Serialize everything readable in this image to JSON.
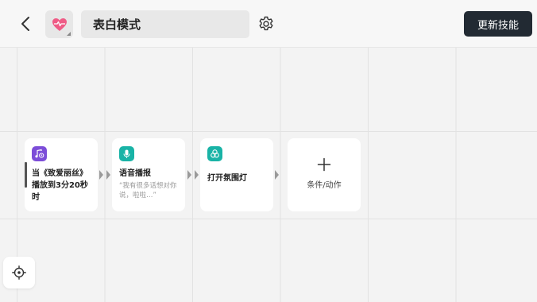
{
  "header": {
    "title": "表白模式",
    "update_button": "更新技能"
  },
  "cards": [
    {
      "icon": "music-timer-icon",
      "color": "#7c4dd8",
      "title": "当《致爱丽丝》播放到3分20秒时",
      "subtitle": ""
    },
    {
      "icon": "microphone-icon",
      "color": "#19b3a6",
      "title": "语音播报",
      "subtitle": "“我有很多话想对你说，啦啦…”"
    },
    {
      "icon": "ambient-light-icon",
      "color": "#19b3a6",
      "title": "打开氛围灯",
      "subtitle": ""
    }
  ],
  "add_card": {
    "label": "条件/动作"
  },
  "colors": {
    "accent_dark": "#222a33",
    "teal": "#19b3a6",
    "purple": "#7c4dd8",
    "heart_pink": "#ef5b86"
  }
}
